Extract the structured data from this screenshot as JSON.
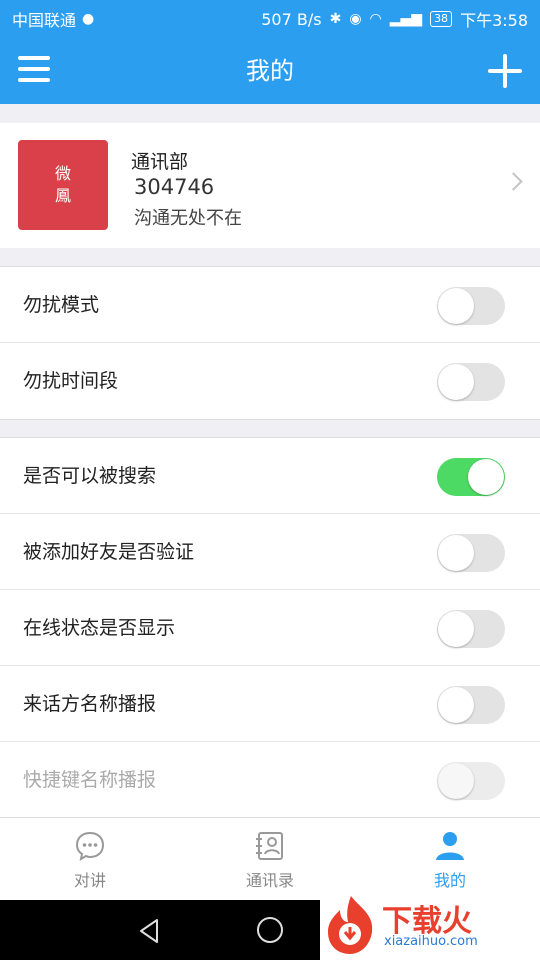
{
  "status_bar": {
    "carrier": "中国联通",
    "network_speed": "507 B/s",
    "battery": "38",
    "time": "下午3:58"
  },
  "header": {
    "title": "我的"
  },
  "profile": {
    "logo_text": "微鳳",
    "name": "通讯部",
    "id": "304746",
    "motto": "沟通无处不在"
  },
  "settings": {
    "group1": [
      {
        "label": "勿扰模式",
        "on": false
      },
      {
        "label": "勿扰时间段",
        "on": false
      }
    ],
    "group2": [
      {
        "label": "是否可以被搜索",
        "on": true
      },
      {
        "label": "被添加好友是否验证",
        "on": false
      },
      {
        "label": "在线状态是否显示",
        "on": false
      },
      {
        "label": "来话方名称播报",
        "on": false
      },
      {
        "label": "快捷键名称播报",
        "on": false,
        "disabled": true
      }
    ]
  },
  "tabs": [
    {
      "label": "对讲",
      "icon": "chat-bubble-icon",
      "active": false
    },
    {
      "label": "通讯录",
      "icon": "contacts-icon",
      "active": false
    },
    {
      "label": "我的",
      "icon": "person-icon",
      "active": true
    }
  ],
  "watermark": {
    "text": "下载火",
    "url": "xiazaihuo.com"
  },
  "colors": {
    "primary": "#2c9ef0",
    "toggle_on": "#4cd964",
    "logo_bg": "#d9404a"
  }
}
